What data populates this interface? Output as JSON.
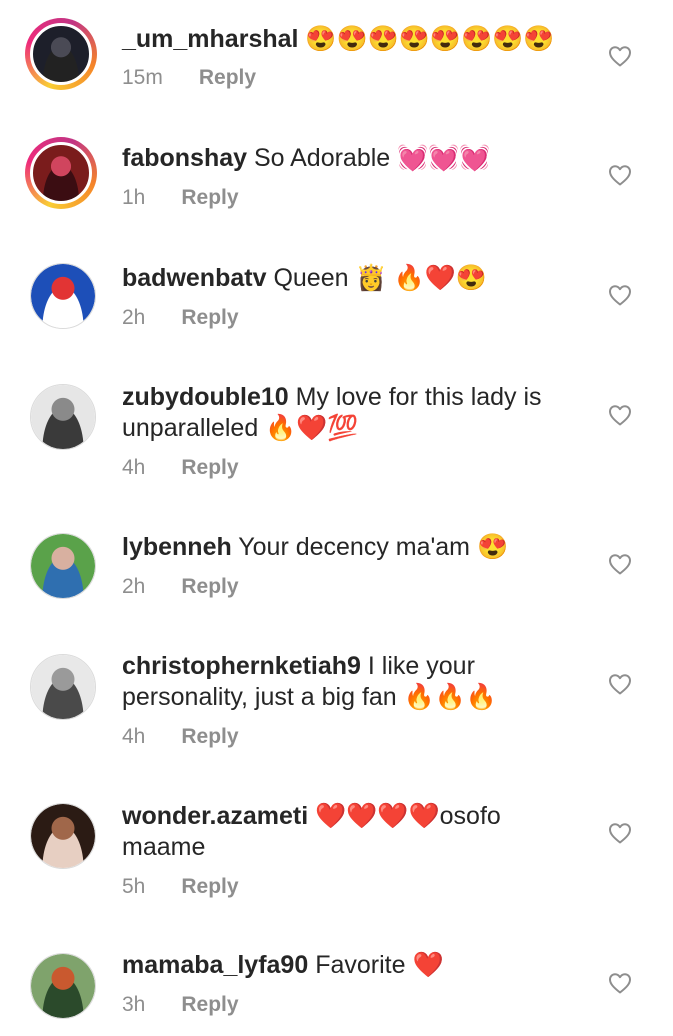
{
  "comments": [
    {
      "username": "_um_mharshal",
      "text": "😍😍😍😍😍😍😍😍",
      "time": "15m",
      "reply": "Reply",
      "avatar_style": "ring",
      "avatar_colors": [
        "#1d1f2a",
        "#4a4a55",
        "#222"
      ]
    },
    {
      "username": "fabonshay",
      "text": "So Adorable 💓💓💓",
      "time": "1h",
      "reply": "Reply",
      "avatar_style": "ring",
      "avatar_colors": [
        "#7a1c1c",
        "#d0455e",
        "#3b0d12"
      ]
    },
    {
      "username": "badwenbatv",
      "text": "Queen 👸 🔥❤️😍",
      "time": "2h",
      "reply": "Reply",
      "avatar_style": "plain",
      "avatar_colors": [
        "#1d4fb8",
        "#e23434",
        "#ffffff"
      ]
    },
    {
      "username": "zubydouble10",
      "text": "My love for this lady is unparalleled 🔥❤️💯",
      "time": "4h",
      "reply": "Reply",
      "avatar_style": "plain",
      "avatar_colors": [
        "#e6e6e6",
        "#8a8a8a",
        "#3a3a3a"
      ]
    },
    {
      "username": "lybenneh",
      "text": "Your decency ma'am 😍",
      "time": "2h",
      "reply": "Reply",
      "avatar_style": "plain",
      "avatar_colors": [
        "#5aa24a",
        "#d8b0a0",
        "#2f6fb0"
      ]
    },
    {
      "username": "christophernketiah9",
      "text": "I like your personality, just a big fan 🔥🔥🔥",
      "time": "4h",
      "reply": "Reply",
      "avatar_style": "plain",
      "avatar_colors": [
        "#e8e8e8",
        "#9a9a9a",
        "#4a4a4a"
      ]
    },
    {
      "username": "wonder.azameti",
      "text": "❤️❤️❤️❤️osofo maame",
      "time": "5h",
      "reply": "Reply",
      "avatar_style": "plain",
      "avatar_colors": [
        "#2b1b14",
        "#a0674a",
        "#e7cfc2"
      ]
    },
    {
      "username": "mamaba_lyfa90",
      "text": "Favorite ❤️",
      "time": "3h",
      "reply": "Reply",
      "avatar_style": "plain",
      "avatar_colors": [
        "#7fa36c",
        "#c9592f",
        "#2b4a2b"
      ]
    }
  ],
  "icons": {
    "like": "heart-outline-icon"
  },
  "colors": {
    "text": "#262626",
    "secondary": "#8e8e8e",
    "background": "#ffffff"
  }
}
